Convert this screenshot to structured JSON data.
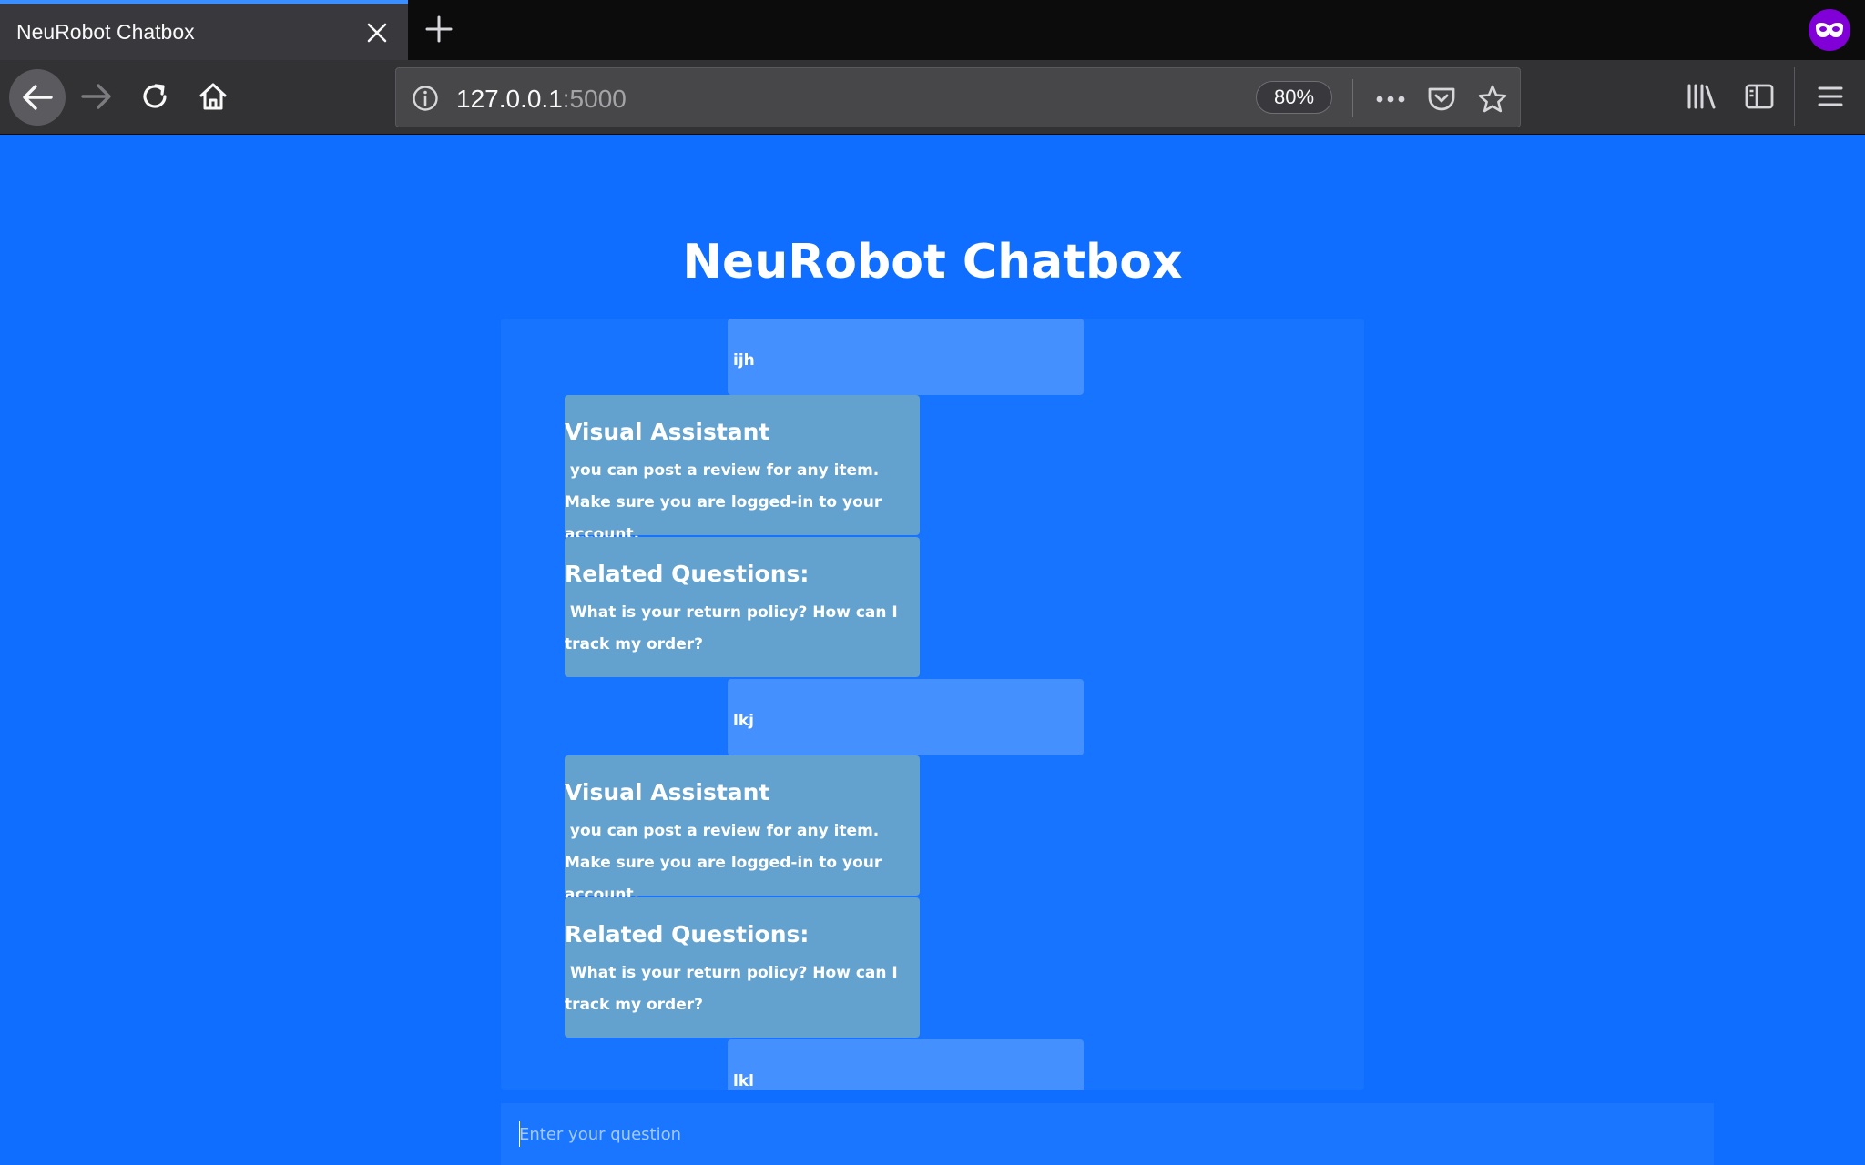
{
  "browser": {
    "tab_title": "NeuRobot Chatbox",
    "url_host": "127.0.0.1",
    "url_port": ":5000",
    "zoom": "80%"
  },
  "page": {
    "title": "NeuRobot Chatbox",
    "input_placeholder": "Enter your question",
    "messages": [
      {
        "role": "user",
        "text": "ijh"
      },
      {
        "role": "bot",
        "heading": "Visual Assistant",
        "text": "you can post a review for any item. Make sure you are logged-in to your account."
      },
      {
        "role": "bot",
        "heading": "Related Questions:",
        "text": "What is your return policy? How can I track my order?"
      },
      {
        "role": "user",
        "text": "lkj"
      },
      {
        "role": "bot",
        "heading": "Visual Assistant",
        "text": "you can post a review for any item. Make sure you are logged-in to your account."
      },
      {
        "role": "bot",
        "heading": "Related Questions:",
        "text": "What is your return policy? How can I track my order?"
      },
      {
        "role": "user",
        "text": "lkl"
      }
    ]
  },
  "colors": {
    "page_bg": "#0f6dff",
    "user_bubble": "#4490ff",
    "bot_bubble": "#63a1ce"
  }
}
